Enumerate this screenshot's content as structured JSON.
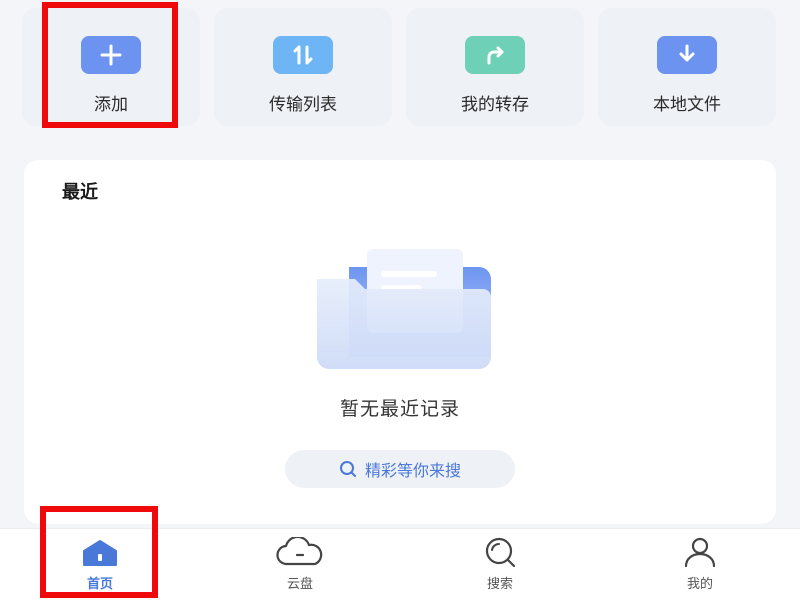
{
  "actions": [
    {
      "label": "添加",
      "icon": "add-icon",
      "color": "#6c93f0"
    },
    {
      "label": "传输列表",
      "icon": "transfer-icon",
      "color": "#6eb5f5"
    },
    {
      "label": "我的转存",
      "icon": "forward-icon",
      "color": "#6fd0b8"
    },
    {
      "label": "本地文件",
      "icon": "download-icon",
      "color": "#6c93f0"
    }
  ],
  "recent": {
    "title": "最近",
    "empty_text": "暂无最近记录",
    "explore_button": "精彩等你来搜"
  },
  "tabs": [
    {
      "label": "首页",
      "icon": "home-icon",
      "active": true
    },
    {
      "label": "云盘",
      "icon": "cloud-icon",
      "active": false
    },
    {
      "label": "搜索",
      "icon": "search-icon",
      "active": false
    },
    {
      "label": "我的",
      "icon": "person-icon",
      "active": false
    }
  ],
  "colors": {
    "accent": "#4a78d8",
    "highlight": "#ee0a0a"
  }
}
